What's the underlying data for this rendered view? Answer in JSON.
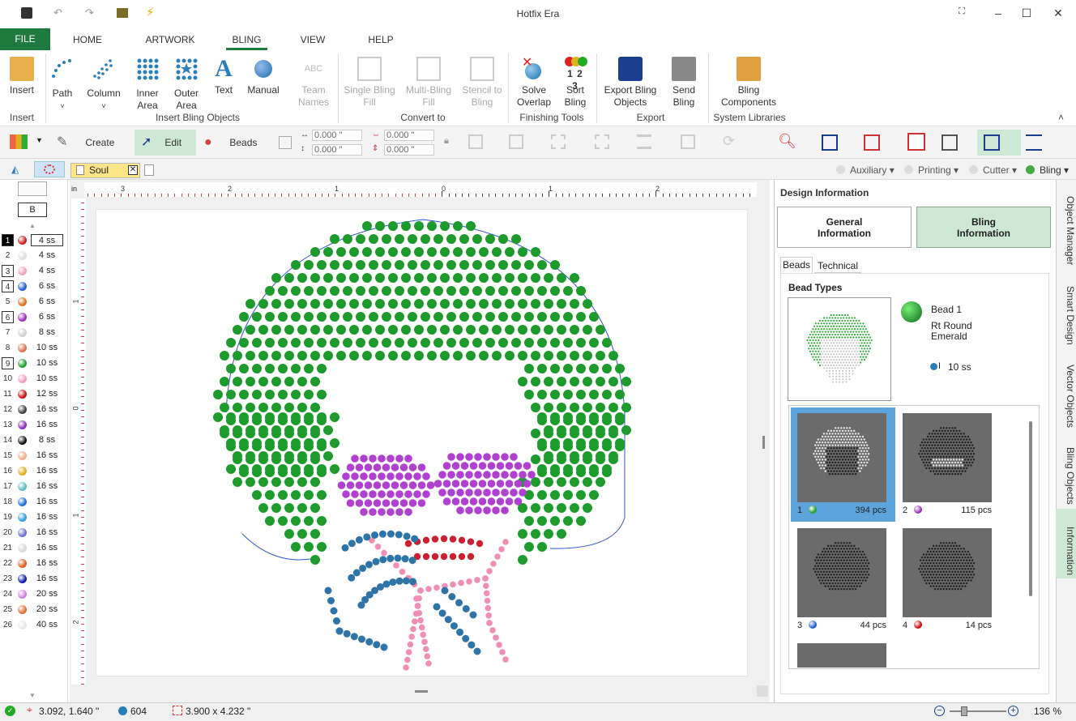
{
  "window": {
    "title": "Hotfix Era"
  },
  "ribbon_tabs": [
    "FILE",
    "HOME",
    "ARTWORK",
    "BLING",
    "VIEW",
    "HELP"
  ],
  "ribbon": {
    "insert": {
      "label": "Insert",
      "group": "Insert"
    },
    "insert_bling": {
      "group": "Insert Bling Objects",
      "path": "Path",
      "column": "Column",
      "inner_area": "Inner Area",
      "outer_area": "Outer Area",
      "text": "Text",
      "manual": "Manual",
      "team_names": "Team Names"
    },
    "convert": {
      "group": "Convert to",
      "single": "Single Bling Fill",
      "multi": "Multi-Bling Fill",
      "stencil": "Stencil to Bling"
    },
    "finishing": {
      "group": "Finishing Tools",
      "solve": "Solve Overlap",
      "sort": "Sort Bling",
      "sort_digits": "1 2 3"
    },
    "export": {
      "group": "Export",
      "export_objects": "Export Bling Objects",
      "send": "Send Bling"
    },
    "system": {
      "group": "System Libraries",
      "components": "Bling Components"
    }
  },
  "toolbar2": {
    "create": "Create",
    "edit": "Edit",
    "beads": "Beads",
    "x": "0.000 \"",
    "y": "0.000 \"",
    "w": "0.000 \"",
    "h": "0.000 \""
  },
  "docbar": {
    "doc_tab": "Soul",
    "modes": [
      "Auxiliary",
      "Printing",
      "Cutter",
      "Bling"
    ]
  },
  "palette_header": "B",
  "palette": [
    {
      "n": "1",
      "size": "4 ss",
      "color": "#d22020"
    },
    {
      "n": "2",
      "size": "4 ss",
      "color": "#e0e0e0"
    },
    {
      "n": "3",
      "size": "4 ss",
      "color": "#f0a0c0"
    },
    {
      "n": "4",
      "size": "6 ss",
      "color": "#2060d0"
    },
    {
      "n": "5",
      "size": "6 ss",
      "color": "#e07020"
    },
    {
      "n": "6",
      "size": "6 ss",
      "color": "#a030c0"
    },
    {
      "n": "7",
      "size": "8 ss",
      "color": "#d0d0d0"
    },
    {
      "n": "8",
      "size": "10 ss",
      "color": "#e07050"
    },
    {
      "n": "9",
      "size": "10 ss",
      "color": "#20a030"
    },
    {
      "n": "10",
      "size": "10 ss",
      "color": "#f0a0c0"
    },
    {
      "n": "11",
      "size": "12 ss",
      "color": "#cc1010"
    },
    {
      "n": "12",
      "size": "16 ss",
      "color": "#404040"
    },
    {
      "n": "13",
      "size": "16 ss",
      "color": "#9030c0"
    },
    {
      "n": "14",
      "size": "8 ss",
      "color": "#111111"
    },
    {
      "n": "15",
      "size": "16 ss",
      "color": "#f0b090"
    },
    {
      "n": "16",
      "size": "16 ss",
      "color": "#e0b020"
    },
    {
      "n": "17",
      "size": "16 ss",
      "color": "#60c0c0"
    },
    {
      "n": "18",
      "size": "16 ss",
      "color": "#2070e0"
    },
    {
      "n": "19",
      "size": "16 ss",
      "color": "#30a0e0"
    },
    {
      "n": "20",
      "size": "16 ss",
      "color": "#7070d0"
    },
    {
      "n": "21",
      "size": "16 ss",
      "color": "#d8d8d8"
    },
    {
      "n": "22",
      "size": "16 ss",
      "color": "#e06020"
    },
    {
      "n": "23",
      "size": "16 ss",
      "color": "#1020b0"
    },
    {
      "n": "24",
      "size": "20 ss",
      "color": "#d080e0"
    },
    {
      "n": "25",
      "size": "20 ss",
      "color": "#e07030"
    },
    {
      "n": "26",
      "size": "40 ss",
      "color": "#e8e8e8"
    }
  ],
  "ruler": {
    "unit": "in",
    "h_ticks": [
      "3",
      "2",
      "1",
      "0",
      "1",
      "2"
    ],
    "v_ticks": [
      "1",
      "0",
      "1",
      "2"
    ]
  },
  "design_info": {
    "title": "Design Information",
    "general": "General Information",
    "bling": "Bling Information",
    "subtabs": [
      "Beads",
      "Technical"
    ],
    "bead_types": "Bead Types",
    "bead_name": "Bead 1",
    "bead_shape": "Rt Round",
    "bead_color": "Emerald",
    "bead_size": "10 ss",
    "bead_size_prefix": "I",
    "items": [
      {
        "n": "1",
        "pcs": "394 pcs",
        "dot": "#20a030"
      },
      {
        "n": "2",
        "pcs": "115 pcs",
        "dot": "#a030c0"
      },
      {
        "n": "3",
        "pcs": "44 pcs",
        "dot": "#2060d0"
      },
      {
        "n": "4",
        "pcs": "14 pcs",
        "dot": "#cc1010"
      }
    ]
  },
  "side_tabs": [
    "Object Manager",
    "Smart Design",
    "Vector Objects",
    "Bling Objects",
    "Information"
  ],
  "status": {
    "cursor": "3.092, 1.640 \"",
    "beads": "604",
    "size": "3.900 x 4.232 \"",
    "zoom": "136 %"
  },
  "colors": {
    "accent": "#1e7a3d",
    "afro": "#1f9a2e",
    "glasses": "#b040d0",
    "lips": "#cc2030",
    "scarf": "#2e74a8",
    "necklace": "#ef8fb5",
    "selected": "#5da3dc"
  }
}
